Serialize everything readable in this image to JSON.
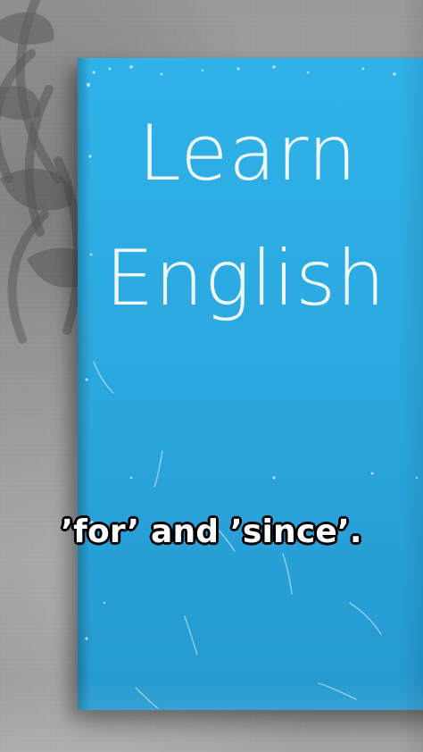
{
  "cover": {
    "title_line_1": "Learn",
    "title_line_2": "English"
  },
  "subtitle": {
    "text": "’for’ and ’since’."
  },
  "colors": {
    "book_blue": "#2aa6dd",
    "caption_fill": "#ffffff",
    "caption_outline": "#000000"
  }
}
